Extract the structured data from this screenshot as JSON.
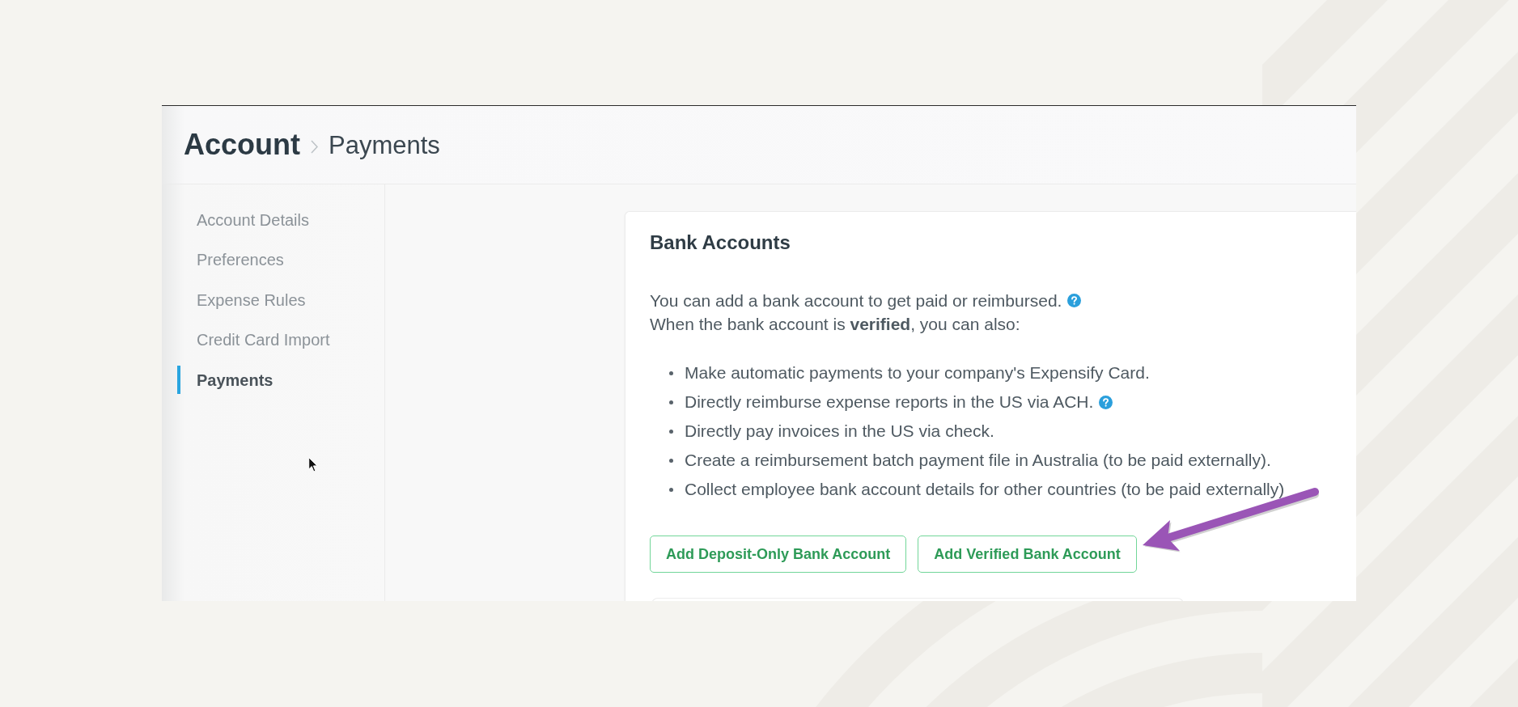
{
  "header": {
    "title": "Account",
    "subtitle": "Payments"
  },
  "sidebar": {
    "items": [
      {
        "label": "Account Details",
        "selected": false
      },
      {
        "label": "Preferences",
        "selected": false
      },
      {
        "label": "Expense Rules",
        "selected": false
      },
      {
        "label": "Credit Card Import",
        "selected": false
      },
      {
        "label": "Payments",
        "selected": true
      }
    ]
  },
  "bank_accounts": {
    "title": "Bank Accounts",
    "intro": [
      {
        "text": "You can add a bank account to get paid or reimbursed.",
        "help": true
      },
      {
        "text": "When the bank account is **verified**, you can also:",
        "help": false
      }
    ],
    "bullets": [
      {
        "text": "Make automatic payments to your company's Expensify Card.",
        "help": false
      },
      {
        "text": "Directly reimburse expense reports in the US via ACH.",
        "help": true
      },
      {
        "text": "Directly pay invoices in the US via check.",
        "help": false
      },
      {
        "text": "Create a reimbursement batch payment file in Australia (to be paid externally).",
        "help": false
      },
      {
        "text": "Collect employee bank account details for other countries (to be paid externally)",
        "help": false
      }
    ],
    "buttons": [
      {
        "label": "Add Deposit-Only Bank Account"
      },
      {
        "label": "Add Verified Bank Account"
      }
    ]
  }
}
